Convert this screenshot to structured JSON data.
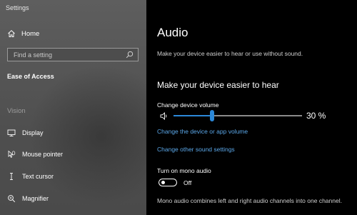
{
  "window": {
    "title": "Settings"
  },
  "sidebar": {
    "home_label": "Home",
    "search_placeholder": "Find a setting",
    "section_heading": "Ease of Access",
    "group_label": "Vision",
    "items": [
      {
        "label": "Display",
        "icon": "monitor-icon"
      },
      {
        "label": "Mouse pointer",
        "icon": "mouse-pointer-icon"
      },
      {
        "label": "Text cursor",
        "icon": "text-cursor-icon"
      },
      {
        "label": "Magnifier",
        "icon": "magnifier-icon"
      }
    ]
  },
  "main": {
    "title": "Audio",
    "subtitle": "Make your device easier to hear or use without sound.",
    "section_title": "Make your device easier to hear",
    "volume": {
      "label": "Change device volume",
      "value_text": "30 %",
      "value": 30
    },
    "link_app_volume": "Change the device or app volume",
    "link_sound_settings": "Change other sound settings",
    "mono": {
      "label": "Turn on mono audio",
      "state": "Off",
      "description": "Mono audio combines left and right audio channels into one channel."
    }
  },
  "colors": {
    "accent": "#2b88d8",
    "link": "#5ba7e8",
    "main_background": "#000000",
    "sidebar_background": "#555555"
  }
}
